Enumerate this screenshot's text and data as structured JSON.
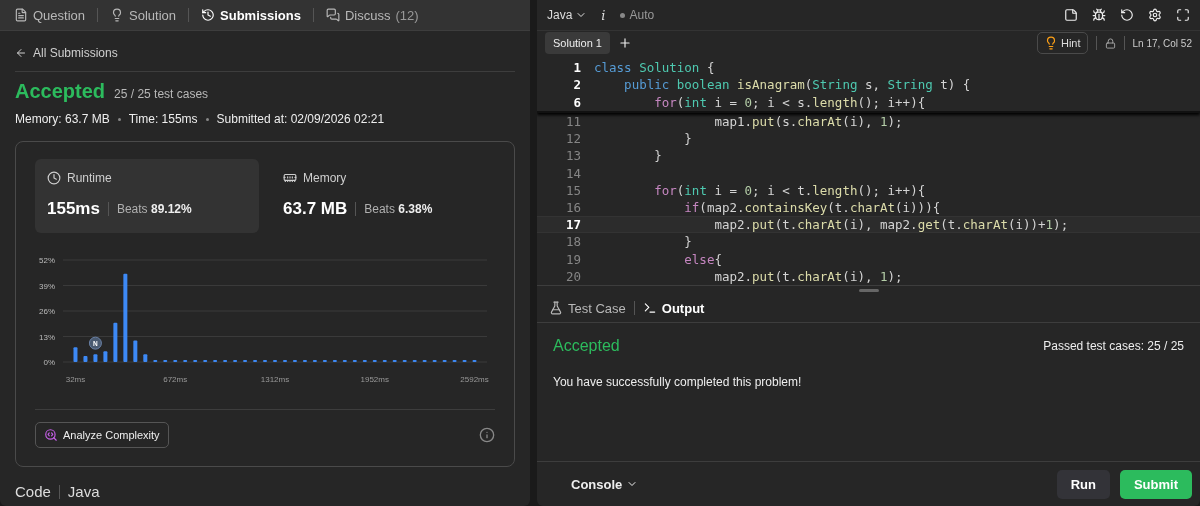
{
  "left_tabs": [
    {
      "label": "Question",
      "selected": false
    },
    {
      "label": "Solution",
      "selected": false
    },
    {
      "label": "Submissions",
      "selected": true
    },
    {
      "label": "Discuss",
      "count": "(12)",
      "selected": false
    }
  ],
  "back_link": "All Submissions",
  "result": {
    "status": "Accepted",
    "tests": "25 / 25 test cases"
  },
  "meta": [
    "Memory: 63.7 MB",
    "Time: 155ms",
    "Submitted at: 02/09/2026 02:21"
  ],
  "stats": [
    {
      "label": "Runtime",
      "value": "155ms",
      "beats": "Beats **89.12%**",
      "selected": true
    },
    {
      "label": "Memory",
      "value": "63.7 MB",
      "beats": "Beats **6.38%**",
      "selected": false
    }
  ],
  "chart_data": {
    "type": "bar",
    "x": [
      32,
      96,
      160,
      224,
      288,
      352,
      416,
      480,
      544,
      608,
      672,
      736,
      800,
      864,
      928,
      992,
      1056,
      1120,
      1184,
      1248,
      1312,
      1376,
      1440,
      1504,
      1568,
      1632,
      1696,
      1760,
      1824,
      1888,
      1952,
      2016,
      2080,
      2144,
      2208,
      2272,
      2336,
      2400,
      2464,
      2528,
      2592
    ],
    "values": [
      7.5,
      3,
      4,
      5.5,
      20,
      45,
      11,
      4,
      1,
      1,
      1,
      1,
      1,
      1,
      1,
      1,
      1,
      1,
      1,
      1,
      1,
      1,
      1,
      1,
      1,
      1,
      1,
      1,
      1,
      1,
      1,
      1,
      1,
      1,
      1,
      1,
      1,
      1,
      1,
      1,
      1
    ],
    "xlim": [
      -48,
      2672
    ],
    "ylim": [
      0,
      52
    ],
    "grid": true,
    "yticks": [
      {
        "value": 0,
        "label": "0%"
      },
      {
        "value": 13,
        "label": "13%"
      },
      {
        "value": 26,
        "label": "26%"
      },
      {
        "value": 39,
        "label": "39%"
      },
      {
        "value": 52,
        "label": "52%"
      }
    ],
    "xticks": [
      {
        "value": 32,
        "label": "32ms"
      },
      {
        "value": 672,
        "label": "672ms"
      },
      {
        "value": 1312,
        "label": "1312ms"
      },
      {
        "value": 1952,
        "label": "1952ms"
      },
      {
        "value": 2592,
        "label": "2592ms"
      }
    ],
    "annotations": [
      {
        "x": 160,
        "text": "N"
      }
    ]
  },
  "analyze_button": "Analyze Complexity",
  "code_header": {
    "title": "Code",
    "language": "Java"
  },
  "editor": {
    "language": "Java",
    "format_icon": "i",
    "mode": "Auto",
    "file_tabs": [
      {
        "label": "Solution 1",
        "selected": true
      }
    ],
    "hint": "Hint",
    "cursor": "Ln 17, Col 52",
    "sticky_lines": [
      {
        "number": "1",
        "tokens": [
          {
            "kind": "kw",
            "text": "class "
          },
          {
            "kind": "type",
            "text": "Solution"
          },
          {
            "kind": "plain",
            "text": " {"
          }
        ]
      },
      {
        "number": "2",
        "tokens": [
          {
            "kind": "kw",
            "text": "    public "
          },
          {
            "kind": "type",
            "text": "boolean "
          },
          {
            "kind": "fn",
            "text": "isAnagram"
          },
          {
            "kind": "plain",
            "text": "("
          },
          {
            "kind": "type",
            "text": "String"
          },
          {
            "kind": "plain",
            "text": " s, "
          },
          {
            "kind": "type",
            "text": "String"
          },
          {
            "kind": "plain",
            "text": " t) {"
          }
        ]
      },
      {
        "number": "6",
        "tokens": [
          {
            "kind": "ctrl",
            "text": "        for"
          },
          {
            "kind": "plain",
            "text": "("
          },
          {
            "kind": "type",
            "text": "int"
          },
          {
            "kind": "plain",
            "text": " i = "
          },
          {
            "kind": "num",
            "text": "0"
          },
          {
            "kind": "plain",
            "text": "; i < s."
          },
          {
            "kind": "fn",
            "text": "length"
          },
          {
            "kind": "plain",
            "text": "(); i++){"
          }
        ]
      }
    ],
    "lines": [
      {
        "number": "11",
        "current": false,
        "tokens": [
          {
            "kind": "plain",
            "text": "                map1."
          },
          {
            "kind": "fn",
            "text": "put"
          },
          {
            "kind": "plain",
            "text": "(s."
          },
          {
            "kind": "fn",
            "text": "charAt"
          },
          {
            "kind": "plain",
            "text": "(i), "
          },
          {
            "kind": "num",
            "text": "1"
          },
          {
            "kind": "plain",
            "text": ");"
          }
        ]
      },
      {
        "number": "12",
        "current": false,
        "tokens": [
          {
            "kind": "plain",
            "text": "            }"
          }
        ]
      },
      {
        "number": "13",
        "current": false,
        "tokens": [
          {
            "kind": "plain",
            "text": "        }"
          }
        ]
      },
      {
        "number": "14",
        "current": false
      },
      {
        "number": "15",
        "current": false,
        "tokens": [
          {
            "kind": "ctrl",
            "text": "        for"
          },
          {
            "kind": "plain",
            "text": "("
          },
          {
            "kind": "type",
            "text": "int"
          },
          {
            "kind": "plain",
            "text": " i = "
          },
          {
            "kind": "num",
            "text": "0"
          },
          {
            "kind": "plain",
            "text": "; i < t."
          },
          {
            "kind": "fn",
            "text": "length"
          },
          {
            "kind": "plain",
            "text": "(); i++){"
          }
        ]
      },
      {
        "number": "16",
        "current": false,
        "tokens": [
          {
            "kind": "ctrl",
            "text": "            if"
          },
          {
            "kind": "plain",
            "text": "(map2."
          },
          {
            "kind": "fn",
            "text": "containsKey"
          },
          {
            "kind": "plain",
            "text": "(t."
          },
          {
            "kind": "fn",
            "text": "charAt"
          },
          {
            "kind": "plain",
            "text": "(i))){"
          }
        ]
      },
      {
        "number": "17",
        "current": true,
        "tokens": [
          {
            "kind": "plain",
            "text": "                map2."
          },
          {
            "kind": "fn",
            "text": "put"
          },
          {
            "kind": "plain",
            "text": "(t."
          },
          {
            "kind": "fn",
            "text": "charAt"
          },
          {
            "kind": "plain",
            "text": "(i), map2."
          },
          {
            "kind": "fn",
            "text": "get"
          },
          {
            "kind": "plain",
            "text": "(t."
          },
          {
            "kind": "fn",
            "text": "charAt"
          },
          {
            "kind": "plain",
            "text": "(i))+"
          },
          {
            "kind": "num",
            "text": "1"
          },
          {
            "kind": "plain",
            "text": ");"
          }
        ]
      },
      {
        "number": "18",
        "current": false,
        "tokens": [
          {
            "kind": "plain",
            "text": "            }"
          }
        ]
      },
      {
        "number": "19",
        "current": false,
        "tokens": [
          {
            "kind": "ctrl",
            "text": "            else"
          },
          {
            "kind": "plain",
            "text": "{"
          }
        ]
      },
      {
        "number": "20",
        "current": false,
        "tokens": [
          {
            "kind": "plain",
            "text": "                map2."
          },
          {
            "kind": "fn",
            "text": "put"
          },
          {
            "kind": "plain",
            "text": "(t."
          },
          {
            "kind": "fn",
            "text": "charAt"
          },
          {
            "kind": "plain",
            "text": "(i), "
          },
          {
            "kind": "num",
            "text": "1"
          },
          {
            "kind": "plain",
            "text": ");"
          }
        ]
      }
    ]
  },
  "bottom": {
    "tabs": [
      {
        "label": "Test Case",
        "selected": false
      },
      {
        "label": "Output",
        "selected": true
      }
    ],
    "status": "Accepted",
    "passed": "Passed test cases: 25 / 25",
    "message": "You have successfully completed this problem!",
    "console": "Console",
    "run": "Run",
    "submit": "Submit"
  }
}
